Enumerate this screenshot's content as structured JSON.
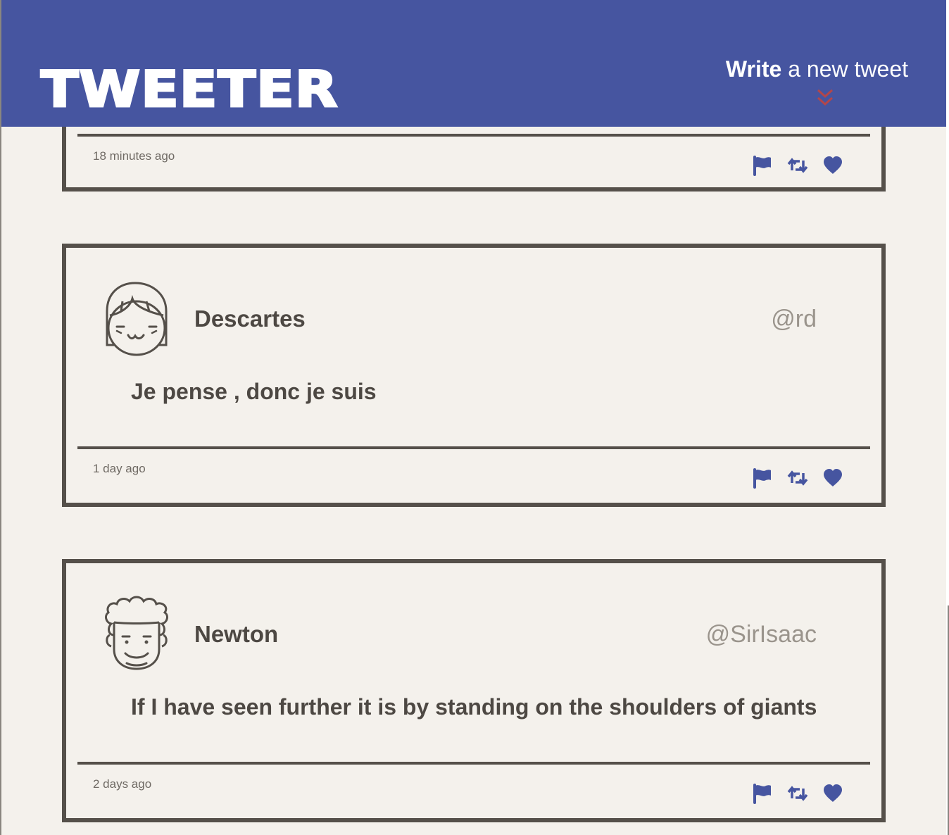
{
  "header": {
    "brand": "TWEETER",
    "compose_bold": "Write",
    "compose_rest": " a new tweet"
  },
  "colors": {
    "nav_bg": "#4655a0",
    "page_bg": "#f4f1ec",
    "border": "#55504a",
    "chevron": "#b3464a",
    "icon": "#4655a0"
  },
  "tweets": [
    {
      "timestamp": "18 minutes ago",
      "actions": [
        "flag-icon",
        "retweet-icon",
        "heart-icon"
      ]
    },
    {
      "author_name": "Descartes",
      "author_handle": "@rd",
      "text": "Je pense , donc je suis",
      "timestamp": "1 day ago",
      "avatar_icon": "girl-avatar-icon",
      "actions": [
        "flag-icon",
        "retweet-icon",
        "heart-icon"
      ]
    },
    {
      "author_name": "Newton",
      "author_handle": "@SirIsaac",
      "text": "If I have seen further it is by standing on the shoulders of giants",
      "timestamp": "2 days ago",
      "avatar_icon": "curly-hair-avatar-icon",
      "actions": [
        "flag-icon",
        "retweet-icon",
        "heart-icon"
      ]
    }
  ]
}
